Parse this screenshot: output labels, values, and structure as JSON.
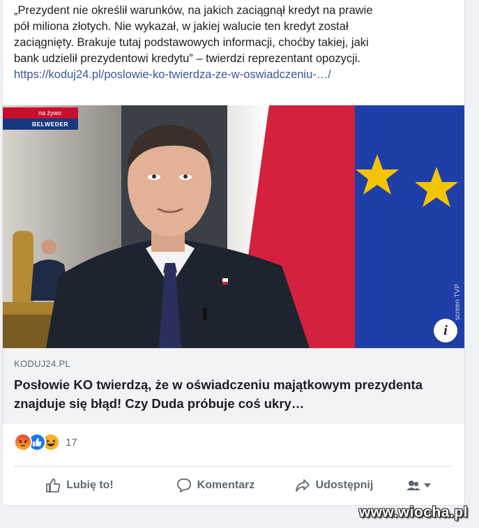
{
  "post": {
    "lines": [
      "„Prezydent nie określił warunków, na jakich zaciągnął kredyt na prawie",
      "pół miliona złotych. Nie wykazał, w jakiej walucie ten kredyt został",
      "zaciągnięty. Brakuje tutaj podstawowych informacji, choćby takiej, jaki",
      "bank udzielił prezydentowi kredytu” – twierdzi reprezentant opozycji."
    ],
    "link": "https://koduj24.pl/poslowie-ko-twierdza-ze-w-oswiadczeniu-…/"
  },
  "media": {
    "live_label": "na żywo",
    "location_label": "BELWEDER",
    "tv_watermark": "screen TVP",
    "info_icon": "i",
    "colors": {
      "flag_red": "#d4213d",
      "eu_blue": "#1f3fa8",
      "eu_star": "#f5c400"
    }
  },
  "preview": {
    "domain": "KODUJ24.PL",
    "headline": "Posłowie KO twierdzą, że w oświadczeniu majątkowym prezydenta znajduje się błąd! Czy Duda próbuje coś ukry…"
  },
  "reactions": {
    "icons": [
      "angry-reaction-icon",
      "like-reaction-icon",
      "haha-reaction-icon"
    ],
    "count": "17"
  },
  "actions": {
    "like": "Lubię to!",
    "comment": "Komentarz",
    "share": "Udostępnij"
  },
  "site_watermark": "www.wiocha.pl"
}
